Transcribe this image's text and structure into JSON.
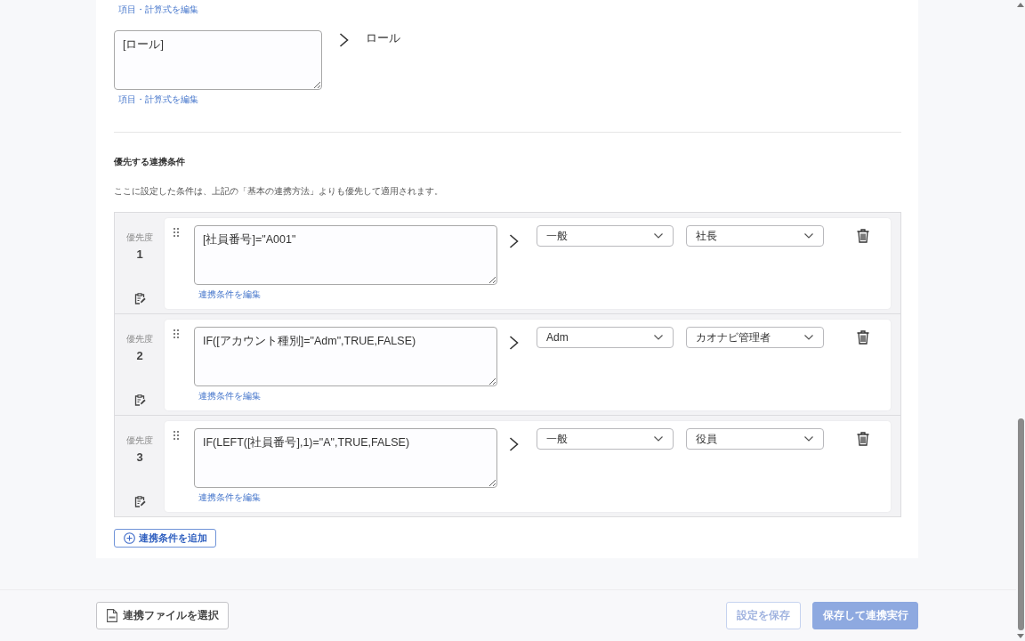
{
  "field_mapping": {
    "previous_edit_link": "項目・計算式を編集",
    "expression": "[ロール]",
    "target": "ロール",
    "edit_link": "項目・計算式を編集"
  },
  "priority_conditions": {
    "title": "優先する連携条件",
    "description": "ここに設定した条件は、上記の「基本の連携方法」よりも優先して適用されます。",
    "rows": [
      {
        "priority_label": "優先度",
        "priority": "1",
        "condition": "[社員番号]=\"A001\"",
        "edit_link": "連携条件を編集",
        "dropdowns": [
          "一般",
          "社長"
        ]
      },
      {
        "priority_label": "優先度",
        "priority": "2",
        "condition": "IF([アカウント種別]=\"Adm\",TRUE,FALSE)",
        "edit_link": "連携条件を編集",
        "dropdowns": [
          "Adm",
          "カオナビ管理者"
        ]
      },
      {
        "priority_label": "優先度",
        "priority": "3",
        "condition": "IF(LEFT([社員番号],1)=\"A\",TRUE,FALSE)",
        "edit_link": "連携条件を編集",
        "dropdowns": [
          "一般",
          "役員"
        ]
      }
    ],
    "add_button": "連携条件を追加"
  },
  "footer": {
    "file_button": "連携ファイルを選択",
    "actions": [
      {
        "label": "設定を保存",
        "kind": "secondary",
        "disabled": true
      },
      {
        "label": "保存して連携実行",
        "kind": "primary",
        "disabled": true
      }
    ]
  }
}
